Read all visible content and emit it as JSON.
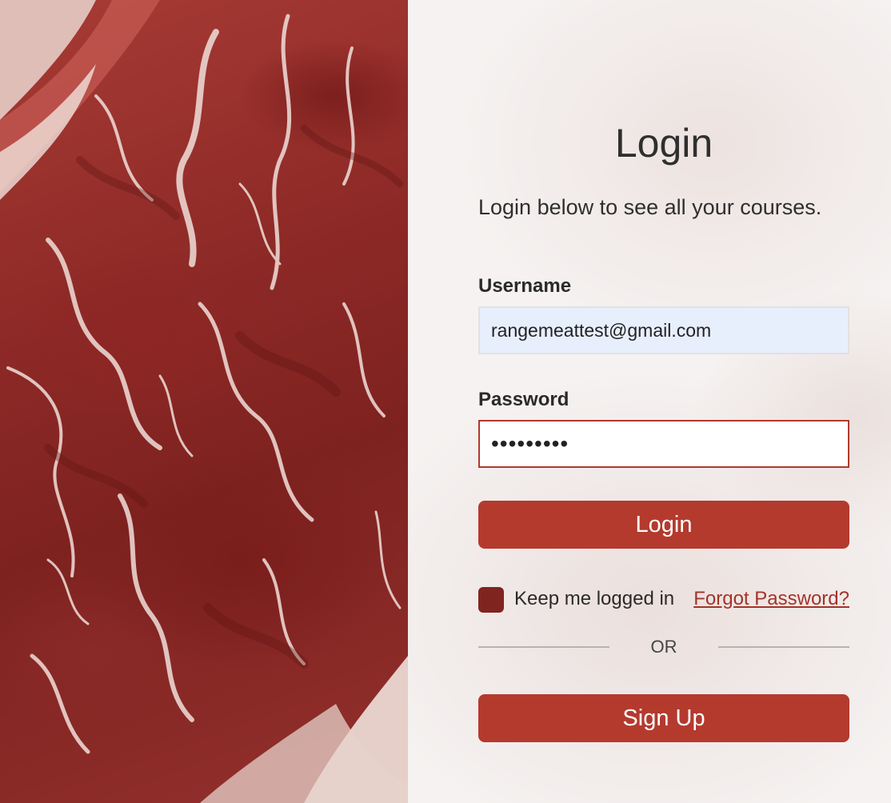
{
  "hero": {
    "image": "raw-meat-marbling-photo"
  },
  "login": {
    "title": "Login",
    "subtitle": "Login below to see all your courses.",
    "username_label": "Username",
    "username_value": "rangemeattest@gmail.com",
    "password_label": "Password",
    "password_value": "•••••••••",
    "login_button": "Login",
    "keep_logged_in_label": "Keep me logged in",
    "forgot_password_link": "Forgot Password?",
    "or_divider": "OR",
    "signup_button": "Sign Up"
  },
  "colors": {
    "accent": "#b43a2e",
    "checkbox": "#80241f",
    "link": "#a33429",
    "username_bg": "#e8effc"
  }
}
